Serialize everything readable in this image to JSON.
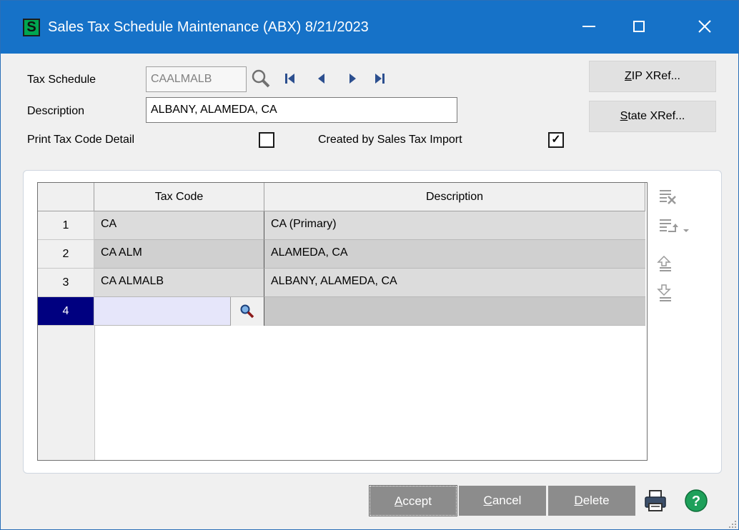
{
  "window": {
    "title": "Sales Tax Schedule Maintenance (ABX) 8/21/2023",
    "app_icon_letter": "S",
    "minimize_icon": "minimize-icon",
    "maximize_icon": "maximize-icon",
    "close_icon": "close-icon"
  },
  "form": {
    "tax_schedule_label": "Tax Schedule",
    "tax_schedule_value": "CAALMALB",
    "description_label": "Description",
    "description_value": "ALBANY, ALAMEDA, CA",
    "print_detail_label": "Print Tax Code Detail",
    "print_detail_checked": false,
    "created_import_label": "Created by Sales Tax Import",
    "created_import_checked": true,
    "check_mark": "✓"
  },
  "side_buttons": {
    "zip_first": "Z",
    "zip_rest": "IP XRef...",
    "state_first": "S",
    "state_rest": "tate XRef..."
  },
  "grid": {
    "columns": [
      "Tax Code",
      "Description"
    ],
    "rows": [
      {
        "num": "1",
        "tax_code": "CA",
        "description": "CA (Primary)"
      },
      {
        "num": "2",
        "tax_code": "CA ALM",
        "description": "ALAMEDA, CA"
      },
      {
        "num": "3",
        "tax_code": "CA ALMALB",
        "description": "ALBANY, ALAMEDA, CA"
      },
      {
        "num": "4",
        "tax_code": "",
        "description": ""
      }
    ],
    "selected_row": "4"
  },
  "buttons": {
    "accept_first": "A",
    "accept_rest": "ccept",
    "cancel_first": "C",
    "cancel_rest": "ancel",
    "delete_first": "D",
    "delete_rest": "elete"
  },
  "colors": {
    "titlebar": "#1672c8",
    "selected_row": "#000080",
    "button_gray": "#8c8c8c",
    "help_green": "#1ea05a"
  }
}
